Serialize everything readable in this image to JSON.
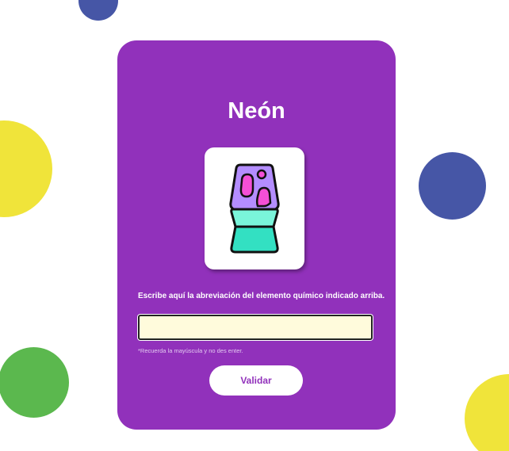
{
  "card": {
    "title": "Neón",
    "image_icon": "lava-lamp-icon",
    "instruction": "Escribe aquí la abreviación del elemento químico indicado arriba.",
    "input": {
      "value": "",
      "placeholder": ""
    },
    "hint": "*Recuerda la mayúscula y no des enter.",
    "button_label": "Validar"
  },
  "colors": {
    "card_background": "#9131bb",
    "input_background": "#fffbdc",
    "decor_blue": "#4656a6",
    "decor_yellow": "#f0e43a",
    "decor_green": "#5bb84e",
    "lamp_top": "#b48dff",
    "lamp_blobs": "#f44fd6",
    "lamp_base": "#33e0c2"
  }
}
